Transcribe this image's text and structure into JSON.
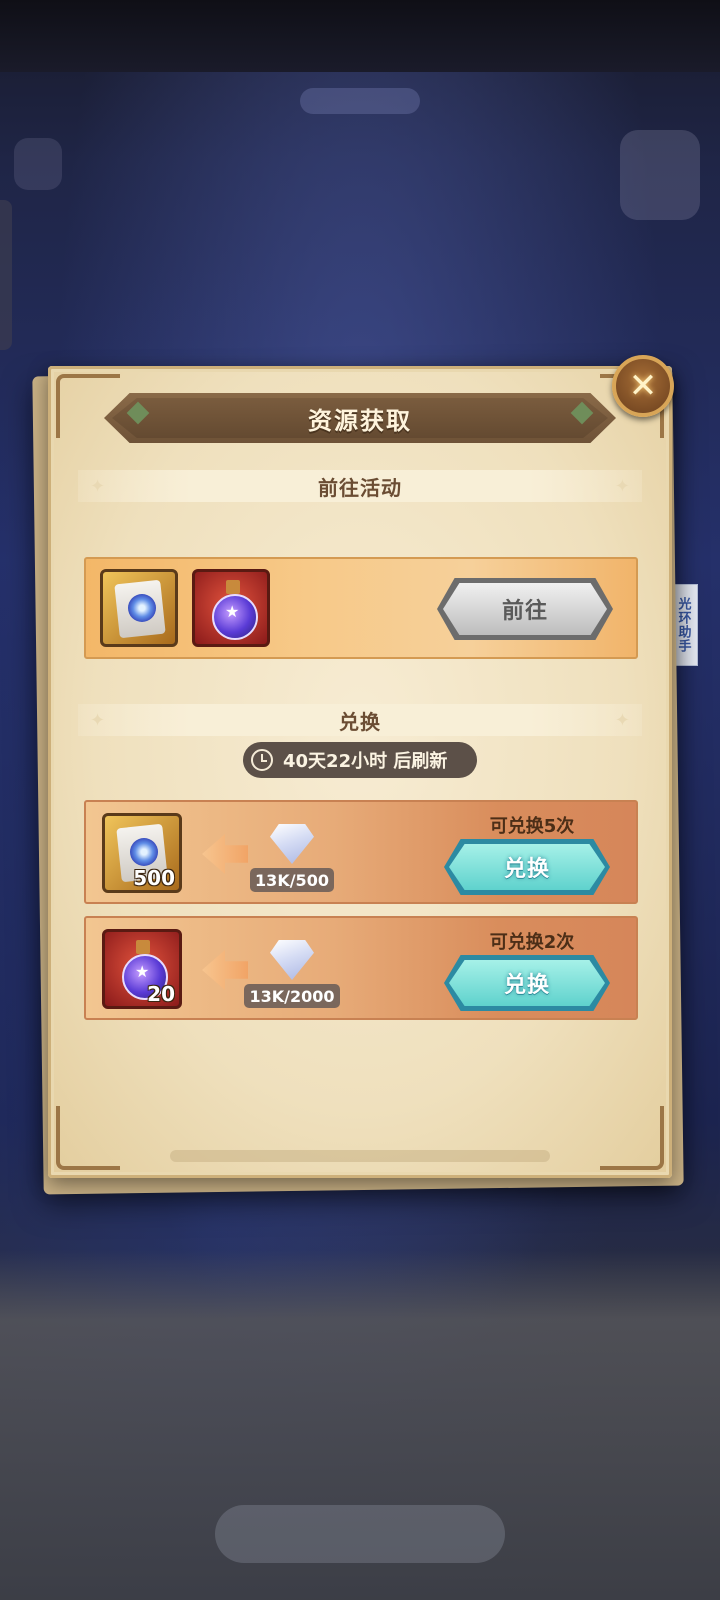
{
  "helper_tab": {
    "label": "光环助手"
  },
  "dialog": {
    "title": "资源获取",
    "close_glyph": "✕"
  },
  "activity_section": {
    "header": "前往活动",
    "items": [
      {
        "icon": "scroll-icon"
      },
      {
        "icon": "potion-icon"
      }
    ],
    "goto_label": "前往"
  },
  "exchange_section": {
    "header": "兑换",
    "timer_text": "40天22小时 后刷新",
    "rows": [
      {
        "item_icon": "scroll-icon",
        "item_qty": "500",
        "cost_icon": "diamond-icon",
        "cost_text": "13K/500",
        "remaining_text": "可兑换5次",
        "button_label": "兑换"
      },
      {
        "item_icon": "potion-icon",
        "item_qty": "20",
        "cost_icon": "diamond-icon",
        "cost_text": "13K/2000",
        "remaining_text": "可兑换2次",
        "button_label": "兑换"
      }
    ]
  },
  "colors": {
    "panel_bg": "#f3e6c8",
    "title_banner": "#6e5237",
    "exchange_button": "#5fd2cd",
    "goto_button": "#bdbdbd"
  }
}
